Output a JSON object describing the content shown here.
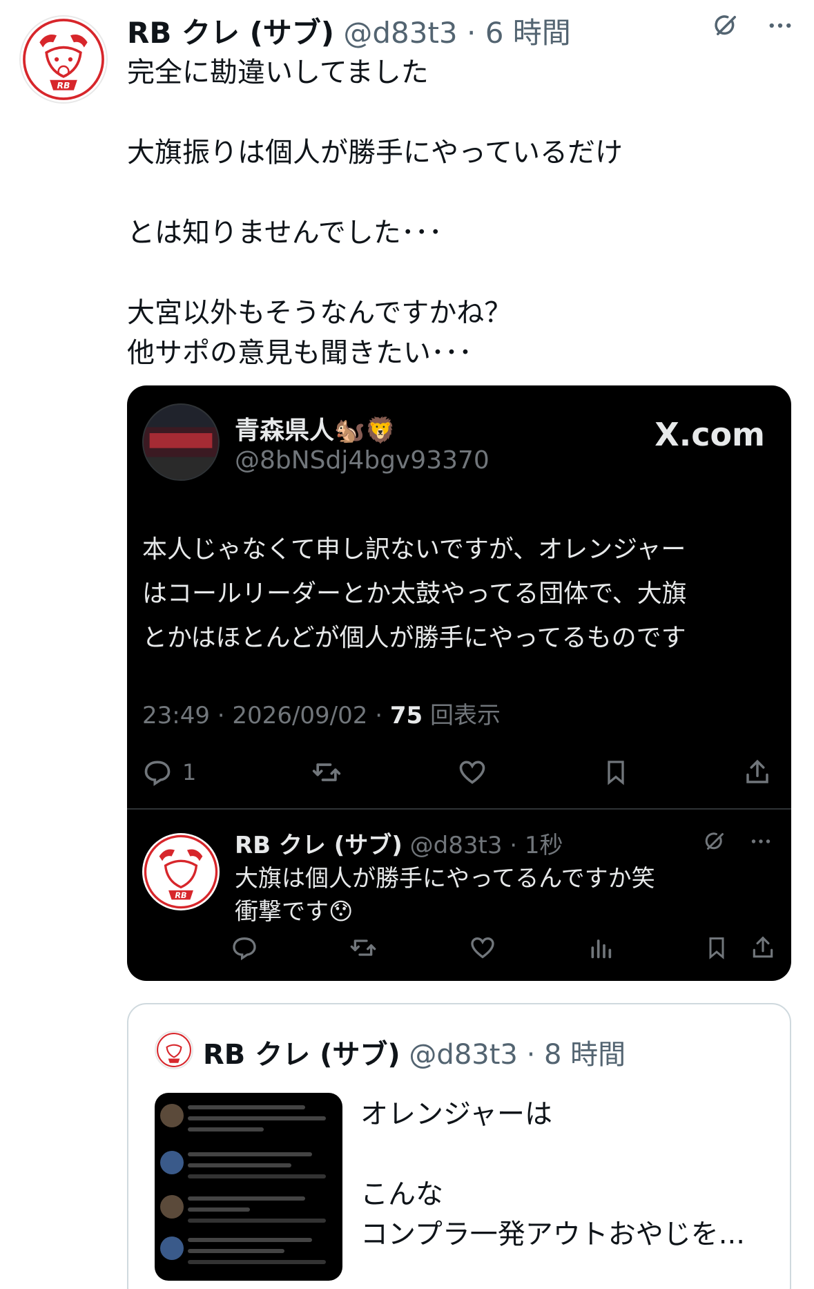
{
  "tweet": {
    "name": "RB クレ (サブ)",
    "handle": "@d83t3",
    "separator": "·",
    "time": "6 時間",
    "lines": [
      "完全に勘違いしてました",
      "",
      "大旗振りは個人が勝手にやっているだけ",
      "",
      "とは知りませんでした･･･",
      "",
      "大宮以外もそうなんですかね？",
      "他サポの意見も聞きたい･･･"
    ]
  },
  "embedded": {
    "quoted_user": {
      "name": "青森県人🐿️🦁",
      "handle": "@8bNSdj4bgv93370",
      "brand": "X.com"
    },
    "body_lines": [
      "本人じゃなくて申し訳ないですが、オレンジャー",
      "はコールリーダーとか太鼓やってる団体で、大旗",
      "とかはほとんどが個人が勝手にやってるものです"
    ],
    "meta": {
      "time": "23:49",
      "date": "2026/09/02",
      "views": "75",
      "views_label": "回表示"
    },
    "reply_count": "1",
    "reply": {
      "name": "RB クレ (サブ)",
      "handle": "@d83t3",
      "time": "1秒",
      "lines": [
        "大旗は個人が勝手にやってるんですか笑",
        "衝撃です😯"
      ]
    }
  },
  "quoted_tweet": {
    "name": "RB クレ (サブ)",
    "handle": "@d83t3",
    "time": "8 時間",
    "lines": [
      "オレンジャーは",
      "",
      "こんな",
      "コンプラ一発アウトおやじを..."
    ]
  },
  "colors": {
    "text": "#0f1419",
    "secondary": "#536471",
    "dark_bg": "#000000",
    "dark_text": "#e7e9ea",
    "dark_secondary": "#71767b",
    "logo_red": "#d7262b"
  },
  "icons": [
    "grok-icon",
    "more-icon",
    "reply-icon",
    "retweet-icon",
    "like-icon",
    "bookmark-icon",
    "share-icon",
    "analytics-icon"
  ]
}
